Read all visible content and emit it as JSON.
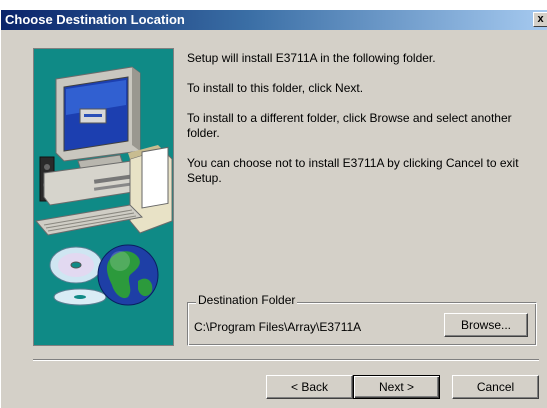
{
  "window": {
    "title": "Choose Destination Location",
    "close_label": "x"
  },
  "body": {
    "line1": "Setup will install E3711A in the following folder.",
    "line2": "To install to this folder, click Next.",
    "line3": "To install to a different folder, click Browse and select another folder.",
    "line4": "You can choose not to install E3711A by clicking Cancel to exit Setup."
  },
  "destination": {
    "legend": "Destination Folder",
    "path": "C:\\Program Files\\Array\\E3711A",
    "browse_label": "Browse..."
  },
  "buttons": {
    "back_label": "< Back",
    "next_label": "Next >",
    "cancel_label": "Cancel"
  },
  "colors": {
    "title_gradient_start": "#0a246a",
    "title_gradient_end": "#a6caf0",
    "dialog_face": "#d4d0c8",
    "art_background": "#0f8a86"
  },
  "icons": {
    "art": "computer-disks-globe-illustration",
    "close": "close-icon"
  }
}
